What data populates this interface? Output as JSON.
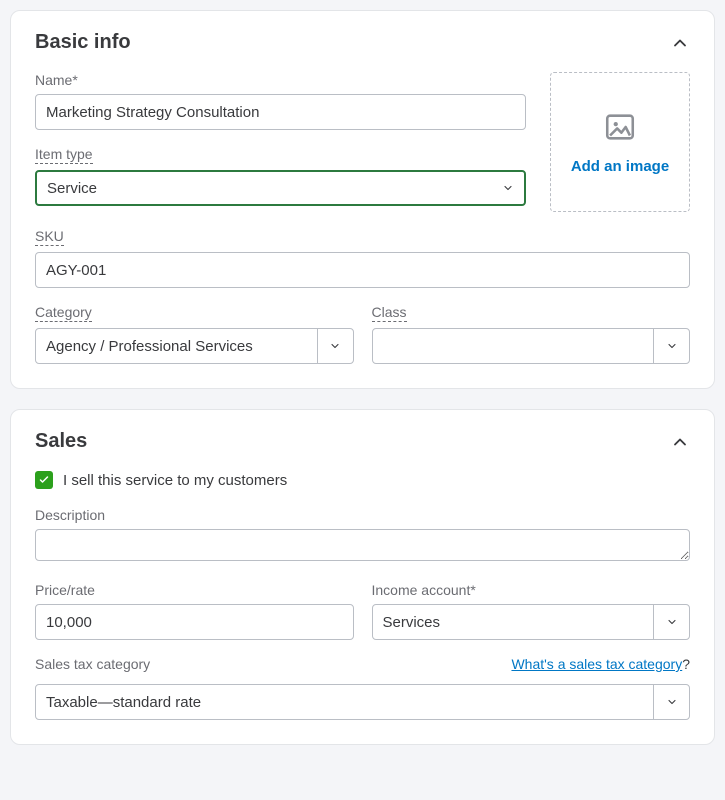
{
  "basic": {
    "title": "Basic info",
    "name_label": "Name*",
    "name_value": "Marketing Strategy Consultation",
    "item_type_label": "Item type",
    "item_type_value": "Service",
    "sku_label": "SKU",
    "sku_value": "AGY-001",
    "category_label": "Category",
    "category_value": "Agency / Professional Services",
    "class_label": "Class",
    "class_value": "",
    "add_image_label": "Add an image"
  },
  "sales": {
    "title": "Sales",
    "sell_checkbox_label": "I sell this service to my customers",
    "description_label": "Description",
    "description_value": "",
    "price_label": "Price/rate",
    "price_value": "10,000",
    "income_account_label": "Income account*",
    "income_account_value": "Services",
    "sales_tax_label": "Sales tax category",
    "sales_tax_link": "What's a sales tax category",
    "sales_tax_value": "Taxable—standard rate"
  }
}
